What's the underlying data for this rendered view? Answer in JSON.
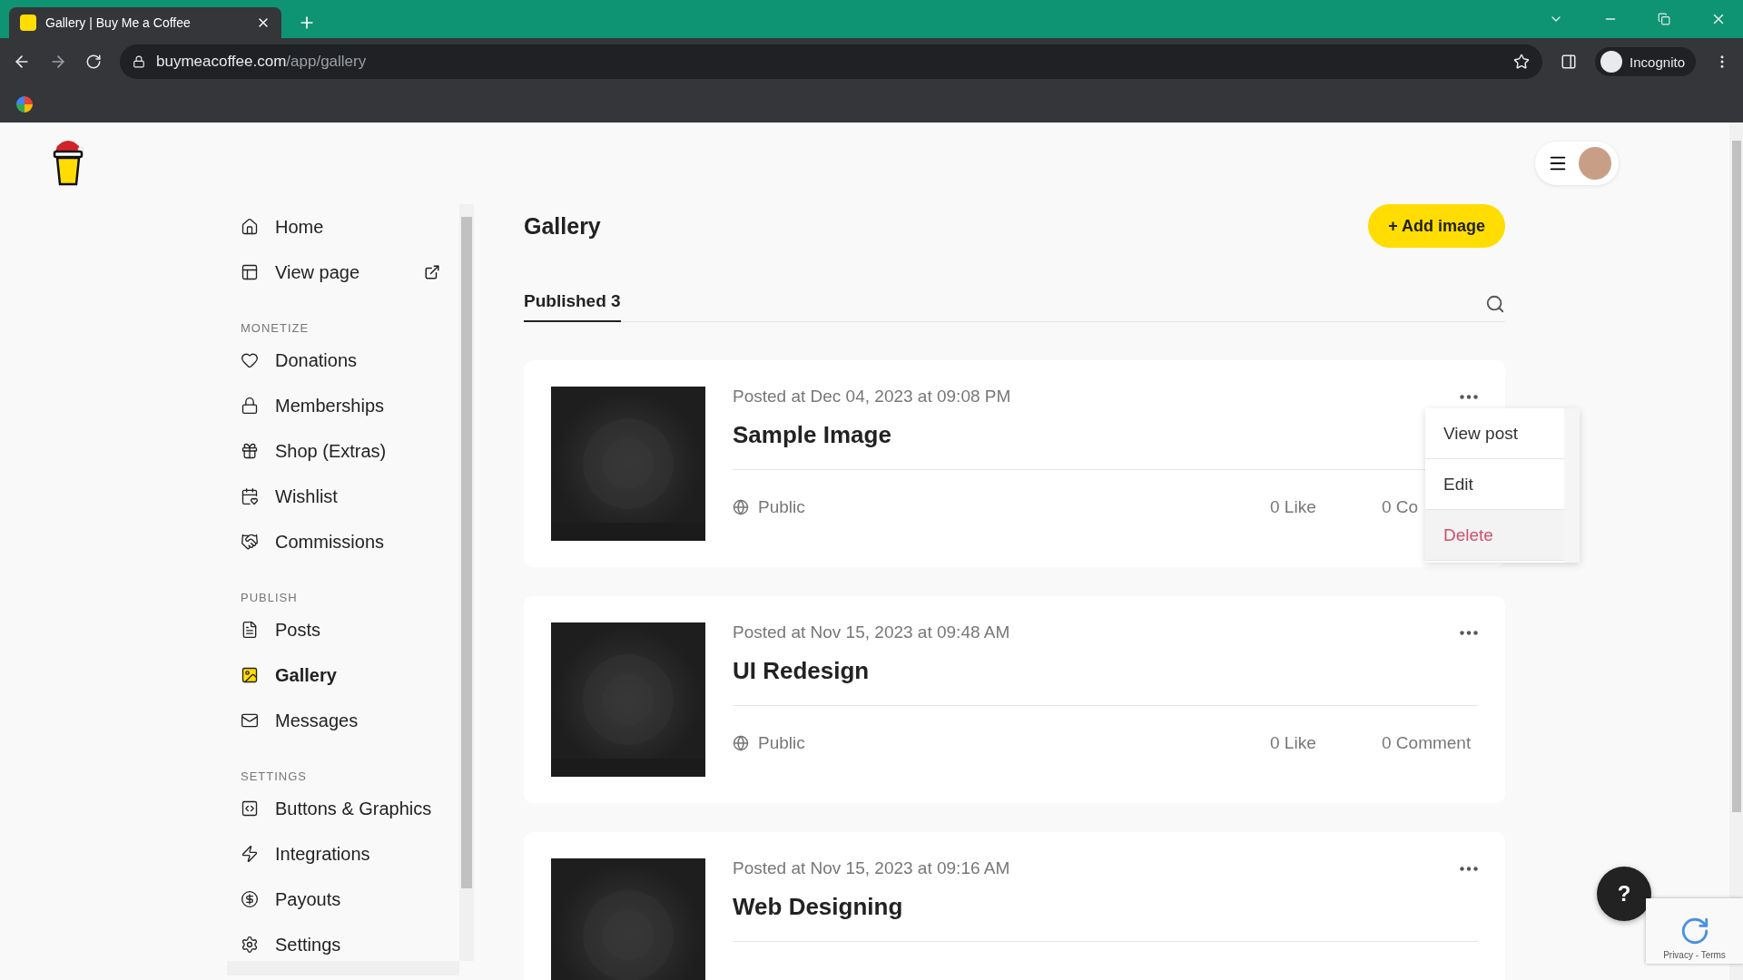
{
  "browser": {
    "tab_title": "Gallery | Buy Me a Coffee",
    "url_domain": "buymeacoffee.com",
    "url_path": "/app/gallery",
    "profile": "Incognito"
  },
  "sidebar": {
    "sections": [
      {
        "items": [
          {
            "label": "Home",
            "selected": false
          },
          {
            "label": "View page",
            "selected": false,
            "external": true
          }
        ]
      },
      {
        "heading": "MONETIZE",
        "items": [
          {
            "label": "Donations",
            "selected": false
          },
          {
            "label": "Memberships",
            "selected": false
          },
          {
            "label": "Shop (Extras)",
            "selected": false
          },
          {
            "label": "Wishlist",
            "selected": false
          },
          {
            "label": "Commissions",
            "selected": false
          }
        ]
      },
      {
        "heading": "PUBLISH",
        "items": [
          {
            "label": "Posts",
            "selected": false
          },
          {
            "label": "Gallery",
            "selected": true
          },
          {
            "label": "Messages",
            "selected": false
          }
        ]
      },
      {
        "heading": "SETTINGS",
        "items": [
          {
            "label": "Buttons & Graphics",
            "selected": false
          },
          {
            "label": "Integrations",
            "selected": false
          },
          {
            "label": "Payouts",
            "selected": false
          },
          {
            "label": "Settings",
            "selected": false
          }
        ]
      }
    ]
  },
  "page": {
    "title": "Gallery",
    "add_button": "+ Add image",
    "tabs": [
      {
        "label": "Published 3",
        "selected": true
      }
    ]
  },
  "posts": [
    {
      "posted": "Posted at Dec 04, 2023 at 09:08 PM",
      "title": "Sample Image",
      "visibility": "Public",
      "likes": "0 Like",
      "comments": "0 Co",
      "menu": [
        {
          "label": "View post",
          "kind": "normal",
          "hovered": false
        },
        {
          "label": "Edit",
          "kind": "normal",
          "hovered": false
        },
        {
          "label": "Delete",
          "kind": "danger",
          "hovered": true
        }
      ]
    },
    {
      "posted": "Posted at Nov 15, 2023 at 09:48 AM",
      "title": "UI Redesign",
      "visibility": "Public",
      "likes": "0 Like",
      "comments": "0 Comment"
    },
    {
      "posted": "Posted at Nov 15, 2023 at 09:16 AM",
      "title": "Web Designing"
    }
  ],
  "help_button": "?",
  "recaptcha": "Privacy - Terms"
}
